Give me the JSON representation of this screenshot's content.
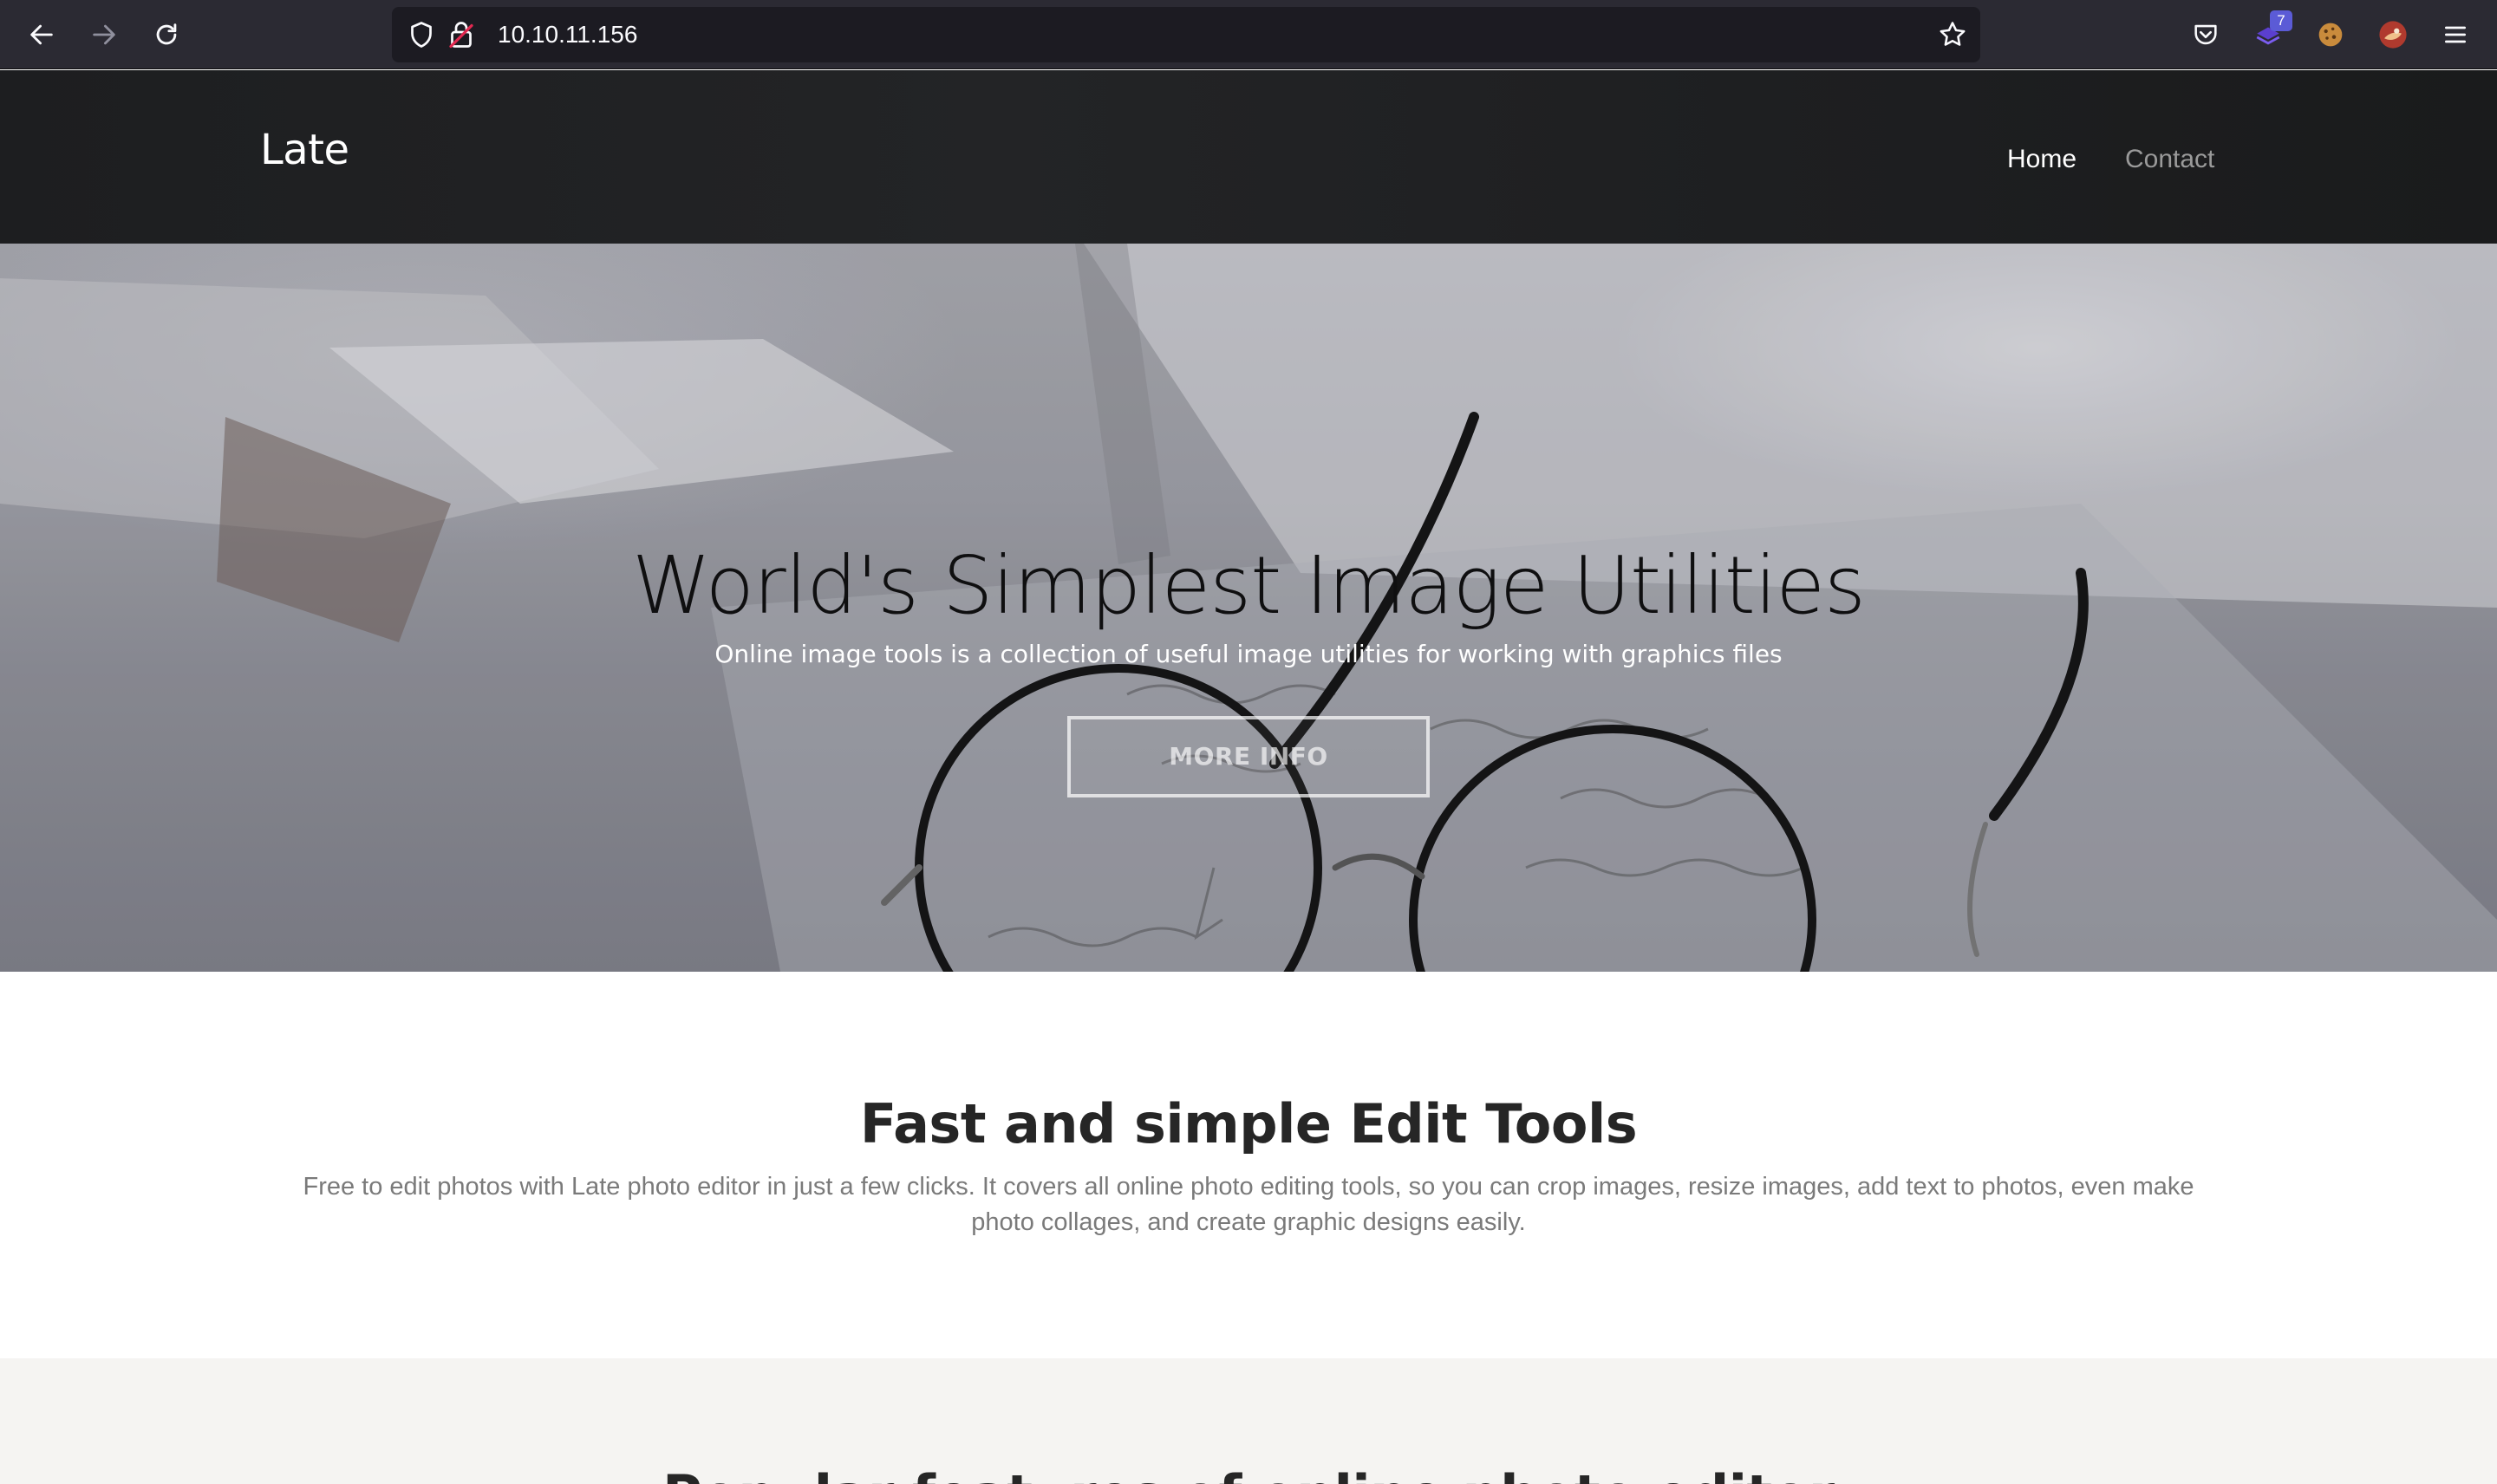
{
  "browser": {
    "url": "10.10.11.156",
    "extension_badge": "7",
    "icons": [
      "back-icon",
      "forward-icon",
      "reload-icon",
      "shield-icon",
      "lock-icon",
      "star-icon",
      "pocket-icon",
      "extension-icon",
      "cookie-icon",
      "avatar-icon",
      "menu-icon"
    ]
  },
  "site": {
    "brand": "Late",
    "nav": {
      "home": "Home",
      "contact": "Contact"
    }
  },
  "hero": {
    "title": "World's Simplest Image Utilities",
    "subtitle": "Online image tools is a collection of useful image utilities for working with graphics files",
    "button": "MORE INFO"
  },
  "features": {
    "title": "Fast and simple Edit Tools",
    "text": "Free to edit photos with Late photo editor in just a few clicks. It covers all online photo editing tools, so you can crop images, resize images, add text to photos, even make photo collages, and create graphic designs easily."
  },
  "popular": {
    "title": "Popular features of online photo editor"
  },
  "colors": {
    "chrome_bg": "#2b2a33",
    "urlbar_bg": "#1c1b22",
    "header_bg": "#1e1f21",
    "nav_inactive": "#9a9a9a",
    "body_text": "#7a7a7a",
    "section_alt_bg": "#f5f4f2"
  }
}
